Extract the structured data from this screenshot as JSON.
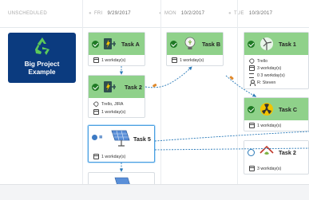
{
  "columns": [
    {
      "label": "UNSCHEDULED",
      "date": ""
    },
    {
      "label": "FRI",
      "date": "9/29/2017"
    },
    {
      "label": "MON",
      "date": "10/2/2017"
    },
    {
      "label": "TUE",
      "date": "10/3/2017"
    }
  ],
  "project": {
    "name_line1": "Big Project",
    "name_line2": "Example"
  },
  "tasks": {
    "task_a": {
      "title": "Task A",
      "duration": "1 workday(s)"
    },
    "task_2_fri": {
      "title": "Task 2",
      "tags": "Trello, JIRA",
      "duration": "1 workday(s)"
    },
    "task_5": {
      "title": "Task 5",
      "duration": "1 workday(s)"
    },
    "task_b": {
      "title": "Task B",
      "duration": "1 workday(s)"
    },
    "task_1": {
      "title": "Task 1",
      "tag": "Trello",
      "duration": "3 workday(s)",
      "progress": "0 3 workday(s)",
      "assignee": "R: Steven"
    },
    "task_c": {
      "title": "Task C",
      "duration": "1 workday(s)"
    },
    "task_2_tue": {
      "title": "Task 2",
      "duration": "3 workday(s)"
    }
  },
  "colors": {
    "done_header": "#8fd18a",
    "project_bg": "#0b3b7f",
    "link": "#2a7ab8",
    "check": "#1f7a24"
  }
}
